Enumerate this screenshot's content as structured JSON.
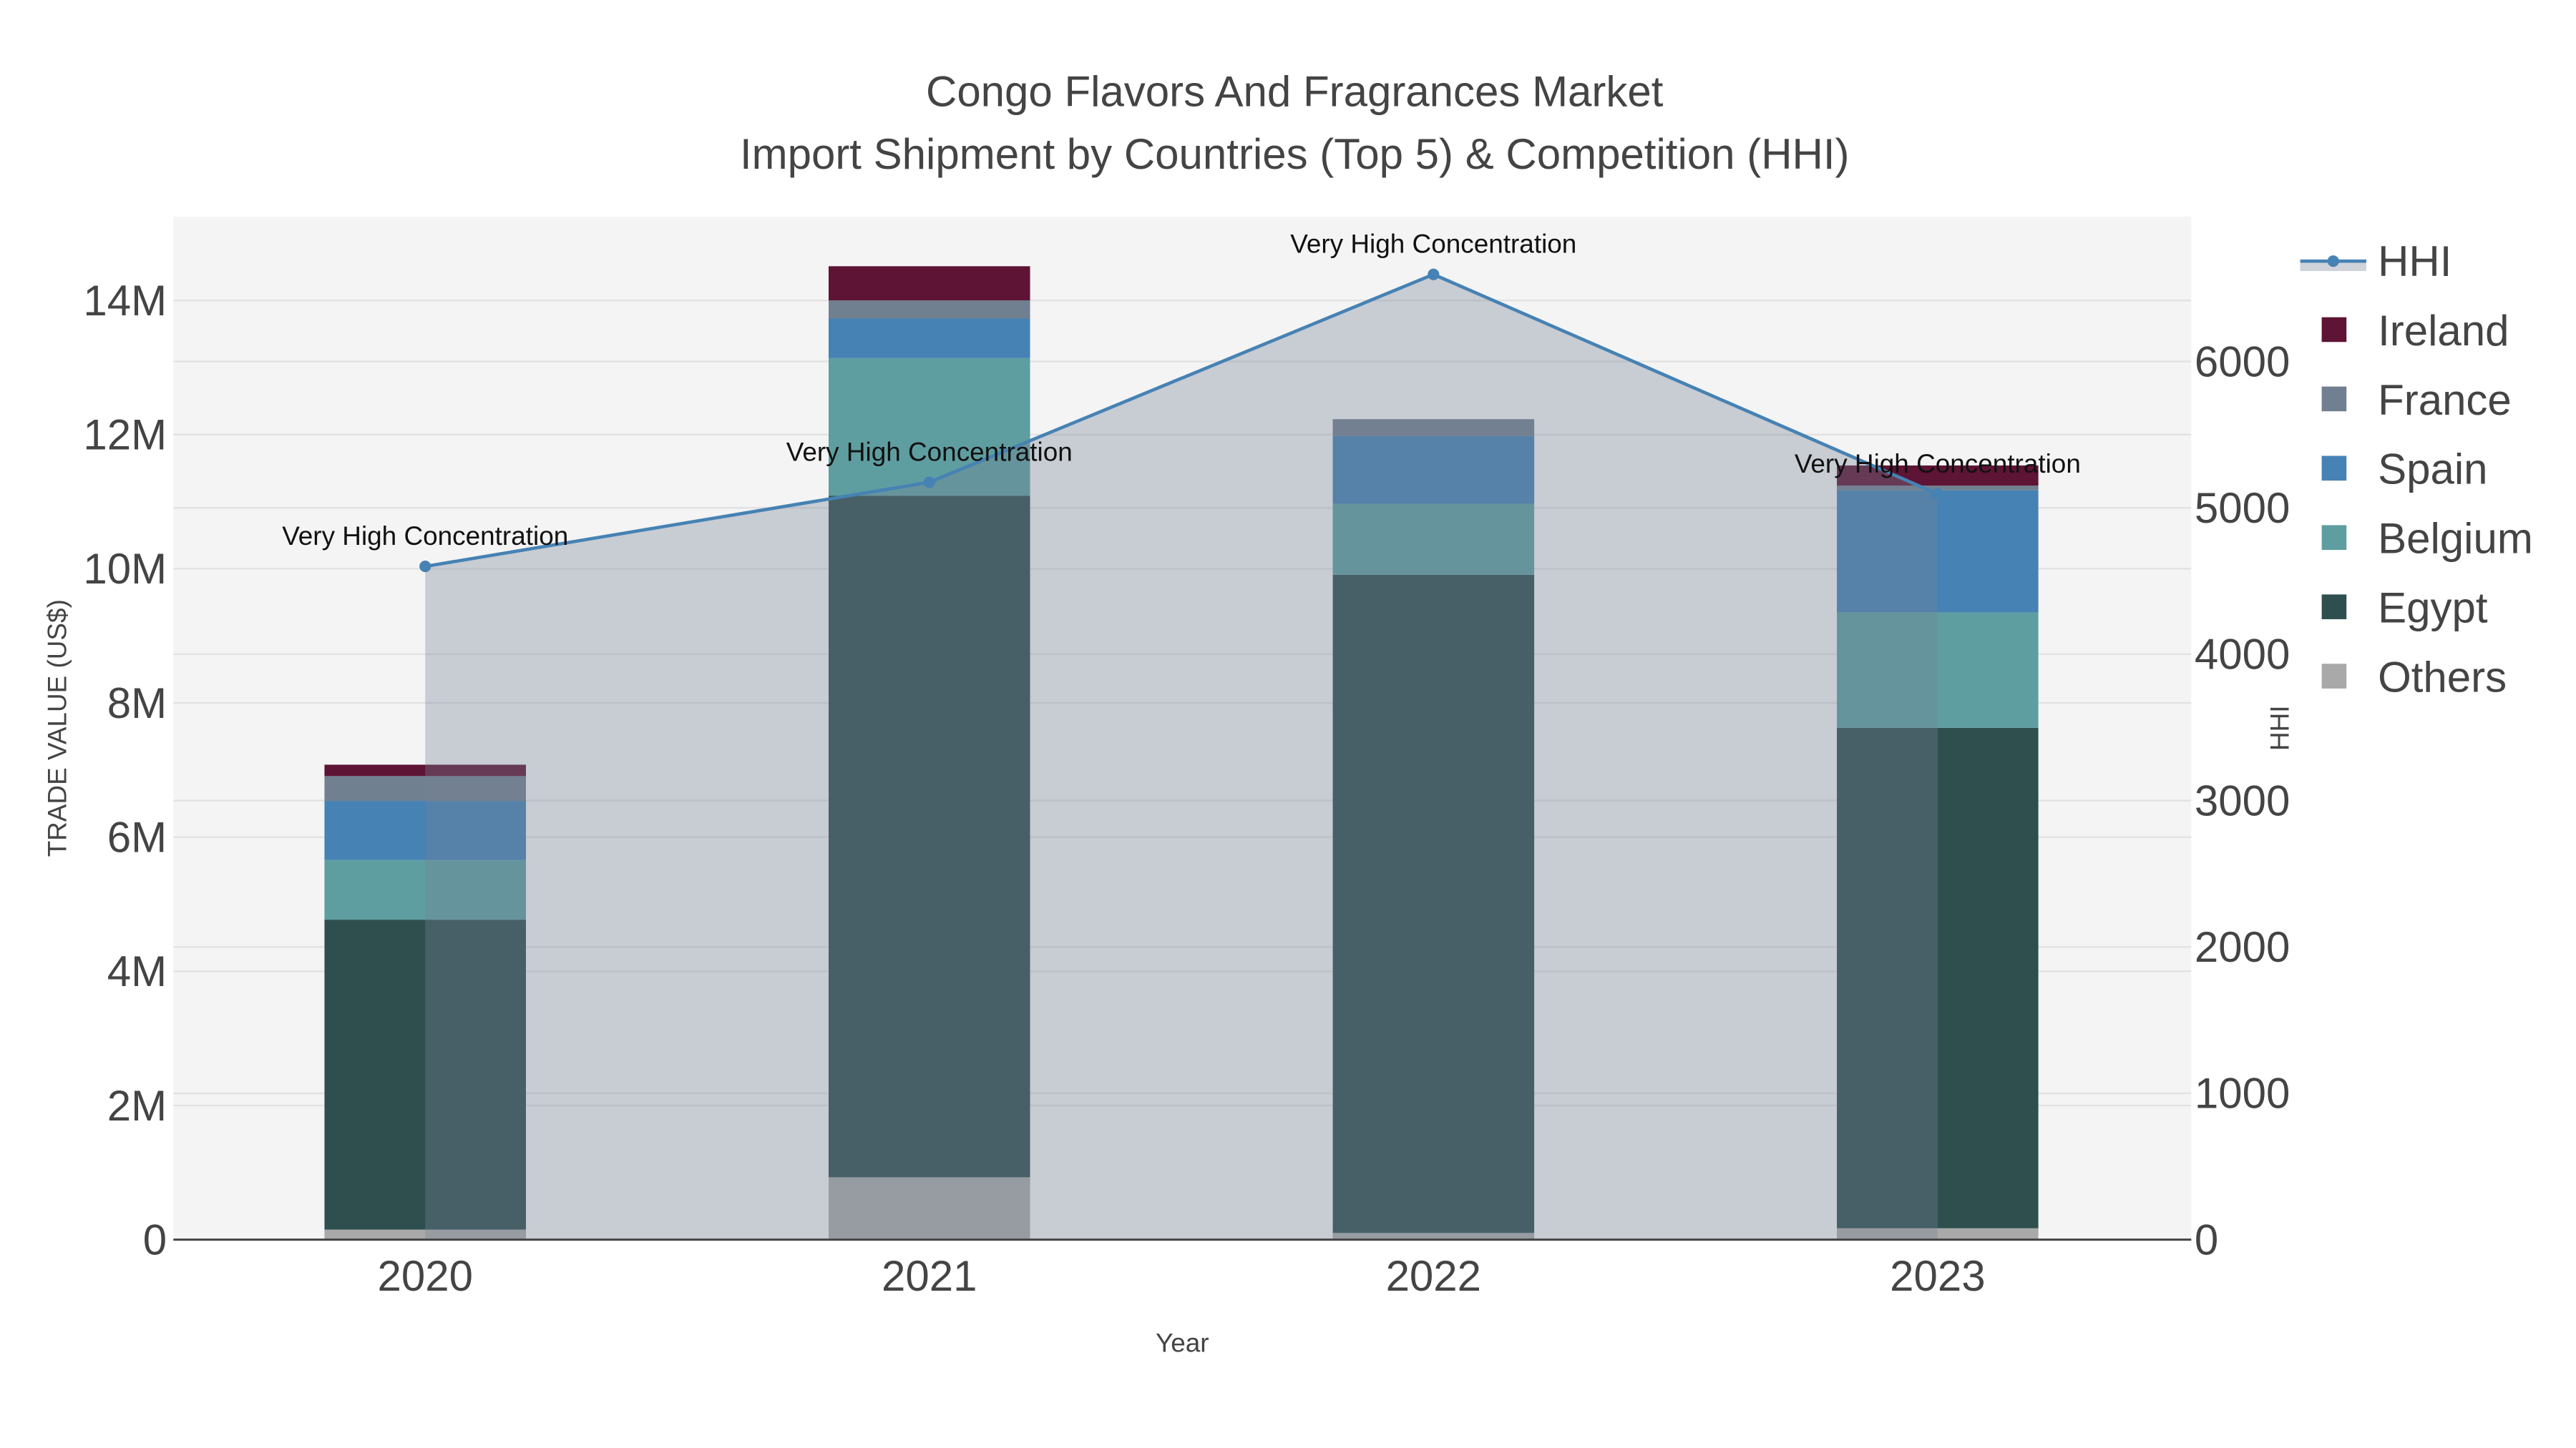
{
  "chart_data": {
    "type": "bar",
    "title_line1": "Congo Flavors And Fragrances Market",
    "title_line2": "Import Shipment by Countries (Top 5) & Competition (HHI)",
    "xlabel": "Year",
    "ylabel": "TRADE VALUE (US$)",
    "y2label": "HHI",
    "categories": [
      "2020",
      "2021",
      "2022",
      "2023"
    ],
    "ylim": [
      0,
      15250000
    ],
    "y2lim": [
      0,
      6990
    ],
    "yticks": [
      0,
      2000000,
      4000000,
      6000000,
      8000000,
      10000000,
      12000000,
      14000000
    ],
    "ytick_labels": [
      "0",
      "2M",
      "4M",
      "6M",
      "8M",
      "10M",
      "12M",
      "14M"
    ],
    "y2ticks": [
      0,
      1000,
      2000,
      3000,
      4000,
      5000,
      6000
    ],
    "y2tick_labels": [
      "0",
      "1000",
      "2000",
      "3000",
      "4000",
      "5000",
      "6000"
    ],
    "grid": true,
    "legend_position": "right",
    "series": [
      {
        "name": "Others",
        "color": "#a9a9a9",
        "values": [
          150000,
          930000,
          100000,
          170000
        ]
      },
      {
        "name": "Egypt",
        "color": "#2f4f4f",
        "values": [
          4620000,
          10160000,
          9810000,
          7460000
        ]
      },
      {
        "name": "Belgium",
        "color": "#5f9ea0",
        "values": [
          890000,
          2050000,
          1060000,
          1720000
        ]
      },
      {
        "name": "Spain",
        "color": "#4682b4",
        "values": [
          880000,
          590000,
          1010000,
          1820000
        ]
      },
      {
        "name": "France",
        "color": "#708090",
        "values": [
          370000,
          270000,
          250000,
          70000
        ]
      },
      {
        "name": "Ireland",
        "color": "#5e1434",
        "values": [
          170000,
          510000,
          0,
          300000
        ]
      }
    ],
    "hhi": {
      "name": "HHI",
      "color": "#4682b4",
      "values": [
        4600,
        5175,
        6595,
        5095
      ],
      "annotations": [
        "Very High Concentration",
        "Very High Concentration",
        "Very High Concentration",
        "Very High Concentration"
      ]
    },
    "legend": [
      "HHI",
      "Ireland",
      "France",
      "Spain",
      "Belgium",
      "Egypt",
      "Others"
    ]
  }
}
